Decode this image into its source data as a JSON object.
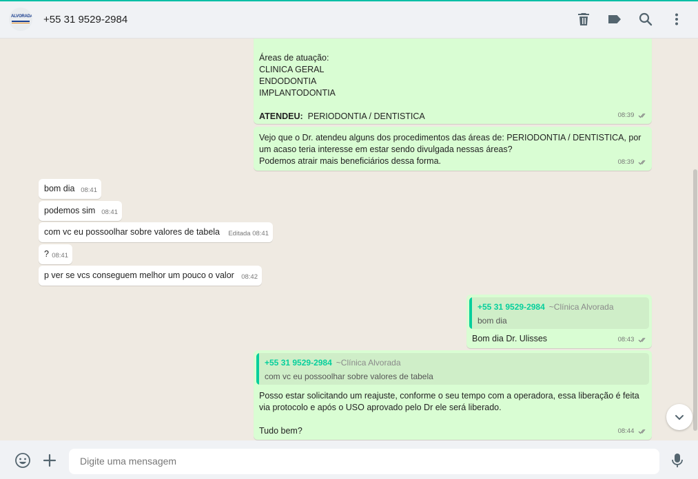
{
  "header": {
    "logo_text": "ALVORADA",
    "contact_title": "+55 31 9529-2984",
    "icons": [
      "trash-icon",
      "tag-icon",
      "search-icon",
      "more-vertical-icon"
    ]
  },
  "messages": {
    "m1": {
      "lines": [
        "Áreas de atuação:",
        "CLINICA GERAL",
        "ENDODONTIA",
        "IMPLANTODONTIA"
      ],
      "attended_label": "ATENDEU:",
      "attended_text": "PERIODONTIA / DENTISTICA",
      "time": "08:39"
    },
    "m2": {
      "lines": [
        "Vejo que o Dr. atendeu alguns dos procedimentos das áreas de:  PERIODONTIA / DENTISTICA, por",
        "um acaso teria interesse em estar sendo divulgada nessas áreas?",
        "Podemos atrair mais beneficiários dessa forma."
      ],
      "time": "08:39"
    },
    "m3": {
      "text": "bom dia",
      "time": "08:41"
    },
    "m4": {
      "text": "podemos sim",
      "time": "08:41"
    },
    "m5": {
      "text": "com vc eu possoolhar sobre valores de tabela",
      "edited": "Editada",
      "time": "08:41"
    },
    "m6": {
      "text": "?",
      "time": "08:41"
    },
    "m7": {
      "text": "p ver se vcs conseguem melhor um pouco o valor",
      "time": "08:42"
    },
    "m8": {
      "quote_name": "+55 31 9529-2984",
      "quote_sender": "~Clínica Alvorada",
      "quote_text": "bom dia",
      "text": "Bom dia Dr. Ulisses",
      "time": "08:43"
    },
    "m9": {
      "quote_name": "+55 31 9529-2984",
      "quote_sender": "~Clínica Alvorada",
      "quote_text": "com vc eu possoolhar sobre valores de tabela",
      "lines": [
        "Posso estar solicitando um reajuste, conforme o seu tempo com a operadora, essa liberação é feita",
        "via protocolo e após o USO aprovado pelo Dr ele será liberado.",
        "",
        "Tudo bem?"
      ],
      "time": "08:44"
    }
  },
  "composer": {
    "placeholder": "Digite uma mensagem",
    "icons": [
      "emoji-icon",
      "plus-icon",
      "microphone-icon"
    ]
  },
  "colors": {
    "outgoing_bubble": "#d9fdd3",
    "incoming_bubble": "#ffffff",
    "accent": "#06cf9c",
    "chat_background": "#efeae2"
  }
}
